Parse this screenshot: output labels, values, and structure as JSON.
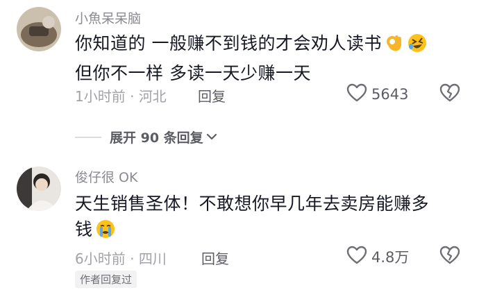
{
  "comments": [
    {
      "username": "小魚呆呆脑",
      "text_line1": "你知道的 一般赚不到钱的才会劝人读书",
      "text_line2": "但你不一样 多读一天少赚一天",
      "emojis": [
        "ok-hand-emoji",
        "rolling-laughing-emoji"
      ],
      "time": "1小时前",
      "location": "河北",
      "reply_label": "回复",
      "likes": "5643"
    },
    {
      "username": "俊仔很 OK",
      "text_line1": "天生销售圣体！不敢想你早几年去卖房能赚多",
      "text_line2": "钱",
      "emojis": [
        "crying-emoji"
      ],
      "time": "6小时前",
      "location": "四川",
      "reply_label": "回复",
      "likes": "4.8万",
      "badge": "作者回复过"
    }
  ],
  "expand_replies": {
    "label": "展开 90 条回复"
  },
  "meta_separator": "·"
}
